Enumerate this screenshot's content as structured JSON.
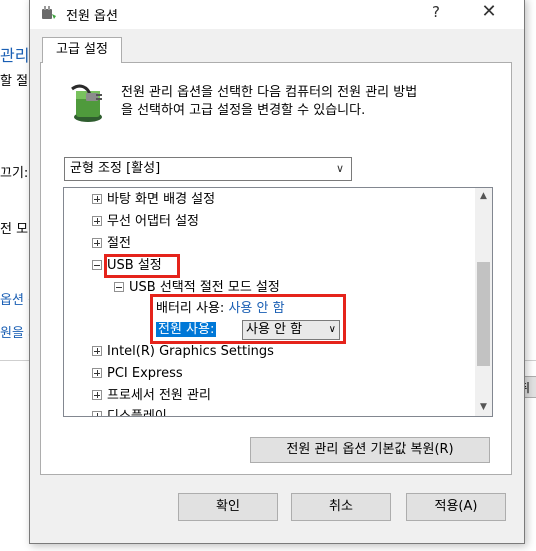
{
  "background_window": {
    "fragments": [
      "관리",
      "할 절",
      "끄기:",
      "전 모",
      "옵션 선",
      "원을 지",
      "취"
    ]
  },
  "dialog": {
    "title": "전원 옵션",
    "help_glyph": "?",
    "close_glyph": "✕",
    "tab_label": "고급 설정",
    "description_line1": "전원 관리 옵션을 선택한 다음 컴퓨터의 전원 관리 방법",
    "description_line2": "을 선택하여 고급 설정을 변경할 수 있습니다.",
    "plan_select": {
      "value": "균형 조정 [활성]",
      "icon": "chevron-down-icon"
    },
    "tree": {
      "items": [
        {
          "label": "바탕 화면 배경 설정",
          "expanded": false
        },
        {
          "label": "무선 어댑터 설정",
          "expanded": false
        },
        {
          "label": "절전",
          "expanded": false
        },
        {
          "label": "USB 설정",
          "expanded": true
        },
        {
          "label": "USB 선택적 절전 모드 설정",
          "expanded": true
        },
        {
          "label": "Intel(R) Graphics Settings",
          "expanded": false
        },
        {
          "label": "PCI Express",
          "expanded": false
        },
        {
          "label": "프로세서 전원 관리",
          "expanded": false
        },
        {
          "label": "디스플레이",
          "expanded": false
        }
      ],
      "battery_label": "배터리 사용:",
      "battery_value": "사용 안 함",
      "plugged_label": "전원 사용:",
      "plugged_value": "사용 안 함"
    },
    "restore_button": "전원 관리 옵션 기본값 복원(R)",
    "ok_button": "확인",
    "cancel_button": "취소",
    "apply_button": "적용(A)"
  },
  "colors": {
    "highlight": "#e5231b",
    "selection": "#0078d7",
    "link": "#1a5fb4"
  }
}
